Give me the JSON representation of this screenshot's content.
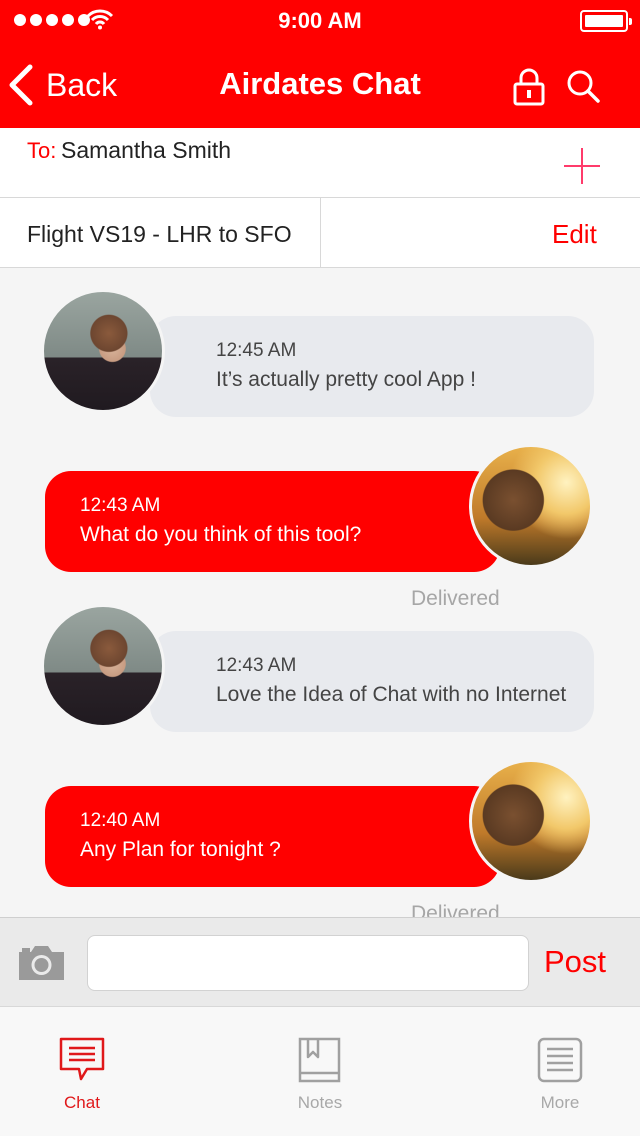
{
  "status_bar": {
    "time": "9:00 AM"
  },
  "nav": {
    "back_label": "Back",
    "title": "Airdates Chat"
  },
  "recipient": {
    "to_label": "To:",
    "name": "Samantha Smith"
  },
  "flight": {
    "label": "Flight VS19 - LHR to SFO",
    "edit_label": "Edit"
  },
  "messages": [
    {
      "direction": "incoming",
      "time": "12:45 AM",
      "text": "It’s actually pretty cool App !"
    },
    {
      "direction": "outgoing",
      "time": "12:43 AM",
      "text": "What do you think of this tool?",
      "status": "Delivered"
    },
    {
      "direction": "incoming",
      "time": "12:43 AM",
      "text": "Love the Idea of Chat with no Internet"
    },
    {
      "direction": "outgoing",
      "time": "12:40 AM",
      "text": "Any Plan for tonight ?",
      "status": "Delivered"
    }
  ],
  "composer": {
    "placeholder": "",
    "post_label": "Post"
  },
  "tabs": [
    {
      "label": "Chat",
      "icon": "chat-icon",
      "active": true
    },
    {
      "label": "Notes",
      "icon": "notes-icon",
      "active": false
    },
    {
      "label": "More",
      "icon": "more-icon",
      "active": false
    }
  ],
  "colors": {
    "accent": "#ff0000",
    "incoming_bubble": "#e8eaee",
    "inactive_tab": "#9b9b9b"
  }
}
